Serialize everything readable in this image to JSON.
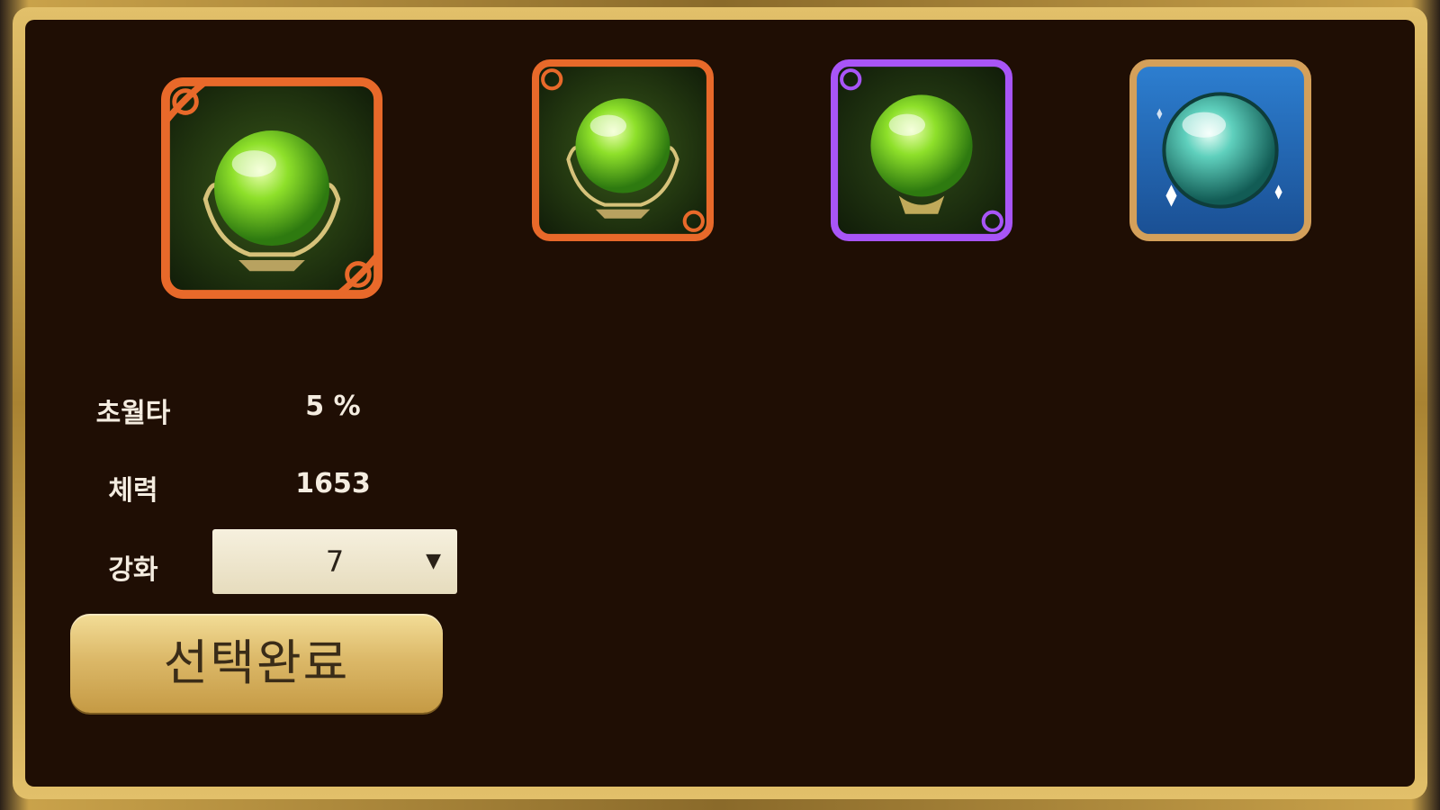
{
  "gems": [
    {
      "name": "green-orb-orange-frame-main",
      "frame_color": "#e8692a",
      "orb_color": "#7ed321",
      "base": "ornate"
    },
    {
      "name": "green-orb-orange-frame",
      "frame_color": "#e8692a",
      "orb_color": "#7ed321",
      "base": "ornate"
    },
    {
      "name": "green-orb-purple-frame",
      "frame_color": "#a855f7",
      "orb_color": "#7ed321",
      "base": "stand"
    },
    {
      "name": "teal-orb-blue-frame",
      "frame_color": "#d4a05a",
      "orb_color": "#3bb5a6",
      "base": "none"
    }
  ],
  "stats": {
    "transcend_label": "초월타",
    "transcend_value": "5 %",
    "hp_label": "체력",
    "hp_value": "1653",
    "enhance_label": "강화",
    "enhance_value": "7"
  },
  "confirm_label": "선택완료",
  "colors": {
    "panel_bg": "#1f0e04",
    "gold_border": "#c9a24a",
    "text": "#f4ece0"
  }
}
